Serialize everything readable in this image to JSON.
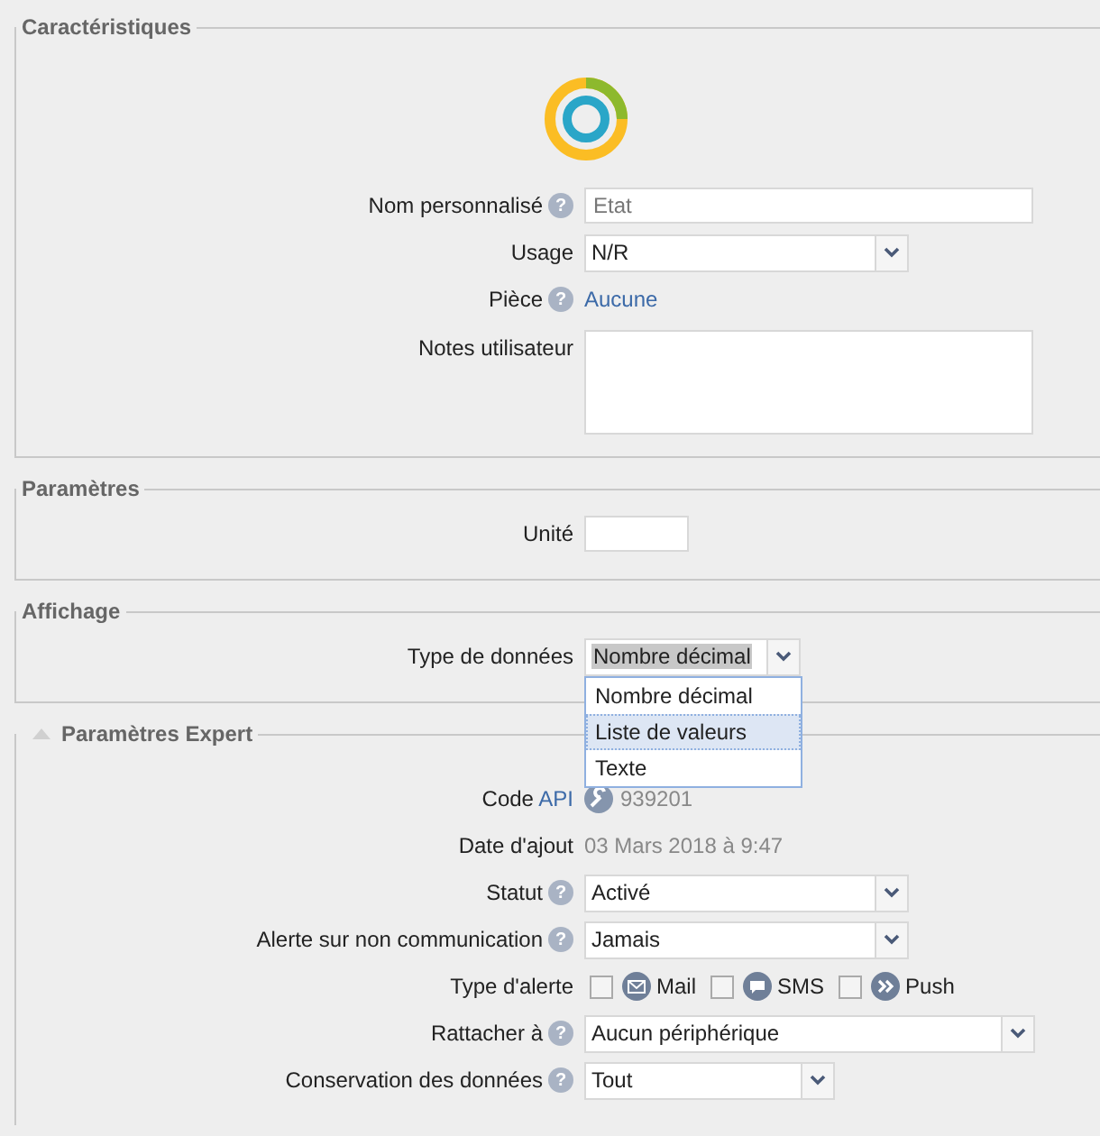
{
  "sections": [
    {
      "legend": "Caractéristiques",
      "logo": true,
      "rows": [
        {
          "kind": "text",
          "label": "Nom personnalisé",
          "help": "?",
          "placeholder": "Etat"
        },
        {
          "kind": "select",
          "label": "Usage",
          "value": "N/R"
        },
        {
          "kind": "link",
          "label": "Pièce",
          "help": "?",
          "value": "Aucune"
        },
        {
          "kind": "textarea",
          "label": "Notes utilisateur"
        }
      ]
    },
    {
      "legend": "Paramètres",
      "rows": [
        {
          "kind": "short-text",
          "label": "Unité"
        }
      ]
    },
    {
      "legend": "Affichage",
      "rows": [
        {
          "kind": "open-select",
          "label": "Type de données",
          "value": "Nombre décimal",
          "options": [
            {
              "label": "Nombre décimal",
              "highlighted": false
            },
            {
              "label": "Liste de valeurs",
              "highlighted": true
            },
            {
              "label": "Texte",
              "highlighted": false
            }
          ]
        }
      ]
    },
    {
      "legend": "Paramètres Expert",
      "collapsible": true,
      "rows": [
        {
          "kind": "code",
          "label": "Code",
          "link": "API",
          "value": "939201"
        },
        {
          "kind": "plain",
          "label": "Date d'ajout",
          "value": "03 Mars 2018 à 9:47"
        },
        {
          "kind": "select",
          "label": "Statut",
          "help": "?",
          "value": "Activé"
        },
        {
          "kind": "select",
          "label": "Alerte sur non communication",
          "help": "?",
          "value": "Jamais"
        },
        {
          "kind": "checks",
          "label": "Type d'alerte",
          "checks": [
            {
              "label": "Mail",
              "checked": false
            },
            {
              "label": "SMS",
              "checked": false
            },
            {
              "label": "Push",
              "checked": false
            }
          ]
        },
        {
          "kind": "wide-select",
          "label": "Rattacher à",
          "help": "?",
          "value": "Aucun périphérique"
        },
        {
          "kind": "short-select",
          "label": "Conservation des données",
          "help": "?",
          "value": "Tout"
        }
      ]
    }
  ]
}
